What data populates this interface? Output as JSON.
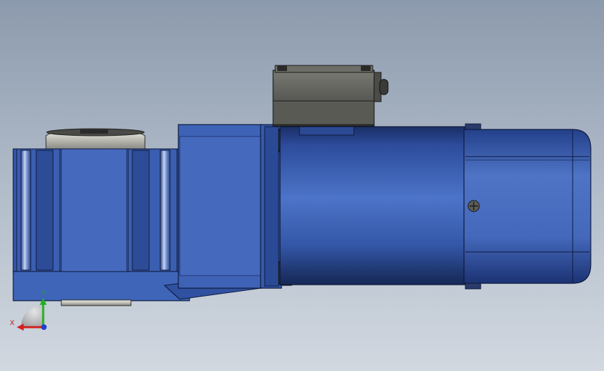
{
  "viewport": {
    "background_top": "#8c9aad",
    "background_bottom": "#d2d8e0"
  },
  "model": {
    "body_color": "#3f63b8",
    "body_dark": "#1d3470",
    "flange_color": "#d7d7d0",
    "terminal_box_color": "#5d5d59"
  },
  "triad": {
    "x_label": "X",
    "y_label": "Y",
    "x_color": "#d22020",
    "y_color": "#22b022",
    "z_color": "#2040d0"
  }
}
